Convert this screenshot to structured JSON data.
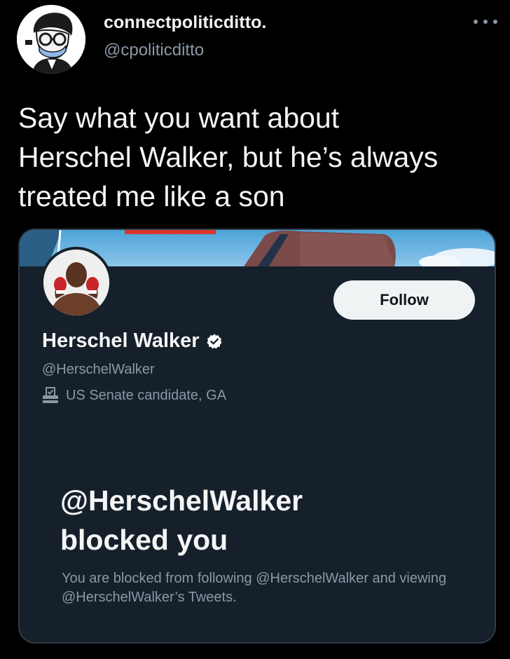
{
  "tweet": {
    "author_name": "connectpoliticditto.",
    "author_handle": "@cpoliticditto",
    "text": "Say what you want about\nHerschel Walker, but he’s always\ntreated me like a son",
    "more_icon": "more-horizontal-icon"
  },
  "embedded_profile": {
    "name": "Herschel Walker",
    "handle": "@HerschelWalker",
    "verified_icon": "verified-badge-icon",
    "bio_icon": "ballot-box-icon",
    "bio": "US Senate candidate, GA",
    "follow_label": "Follow",
    "blocked_title": "@HerschelWalker\nblocked you",
    "blocked_description": "You are blocked from following @HerschelWalker and viewing @HerschelWalker’s Tweets."
  },
  "colors": {
    "background": "#000000",
    "card_background": "#15202b",
    "card_border": "#2f3a45",
    "secondary_text": "#8b98a5",
    "primary_text": "#f5f5f5",
    "follow_button_bg": "#eff3f4"
  }
}
